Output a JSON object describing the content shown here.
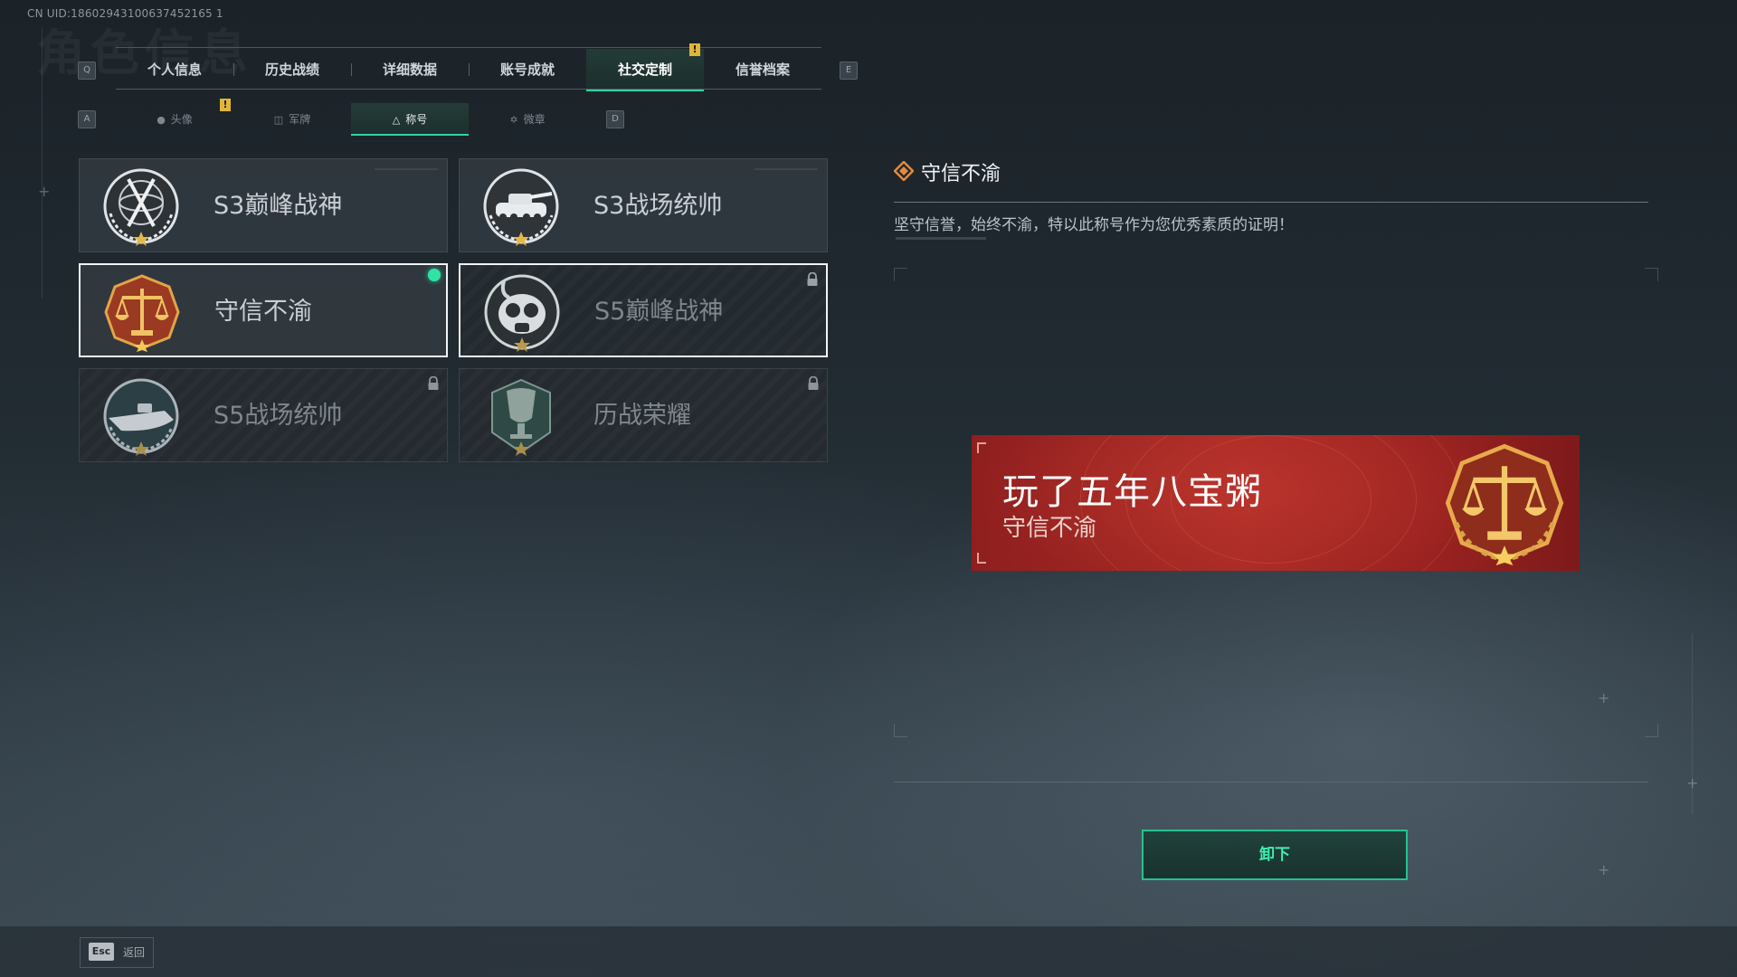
{
  "uid_text": "CN UID:18602943100637452165 1",
  "tabs": {
    "left_key": "Q",
    "right_key": "E",
    "items": [
      "个人信息",
      "历史战绩",
      "详细数据",
      "账号成就",
      "社交定制",
      "信誉档案"
    ],
    "active_index": 4,
    "alert_badge": "!"
  },
  "subtabs": {
    "left_key": "A",
    "right_key": "D",
    "items": [
      "头像",
      "军牌",
      "称号",
      "微章"
    ],
    "active_index": 2,
    "alert_badge": "!"
  },
  "titles": [
    {
      "label": "S3巅峰战神",
      "locked": false,
      "selected": false,
      "equipped": false,
      "icon": "scales-globe-emblem-icon"
    },
    {
      "label": "S3战场统帅",
      "locked": false,
      "selected": false,
      "equipped": false,
      "icon": "tank-emblem-icon"
    },
    {
      "label": "守信不渝",
      "locked": false,
      "selected": true,
      "equipped": true,
      "icon": "justice-scales-emblem-icon"
    },
    {
      "label": "S5巅峰战神",
      "locked": true,
      "selected": true,
      "equipped": false,
      "icon": "gas-mask-emblem-icon"
    },
    {
      "label": "S5战场统帅",
      "locked": true,
      "selected": false,
      "equipped": false,
      "icon": "boat-emblem-icon"
    },
    {
      "label": "历战荣耀",
      "locked": true,
      "selected": false,
      "equipped": false,
      "icon": "trophy-emblem-icon"
    }
  ],
  "detail": {
    "title": "守信不渝",
    "description": "坚守信誉，始终不渝，特以此称号作为您优秀素质的证明！"
  },
  "banner": {
    "player_name": "玩了五年八宝粥",
    "title": "守信不渝"
  },
  "unequip_button": "卸下",
  "footer": {
    "esc_key": "Esc",
    "back_label": "返回"
  },
  "colors": {
    "accent": "#2fd3a3",
    "badge": "#e1b53a",
    "banner_red": "#a82a25",
    "equipped_dot": "#2ee3a5"
  }
}
